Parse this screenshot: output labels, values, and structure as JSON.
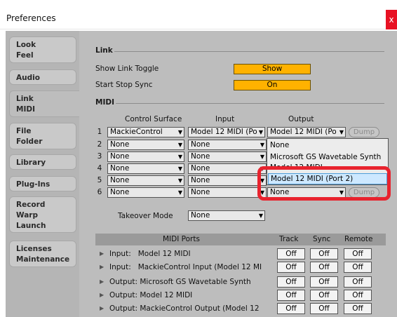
{
  "window": {
    "title": "Preferences",
    "close_glyph": "x"
  },
  "sidebar": {
    "tabs": [
      {
        "label": "Look\nFeel"
      },
      {
        "label": "Audio"
      },
      {
        "label": "Link\nMIDI",
        "active": true
      },
      {
        "label": "File\nFolder"
      },
      {
        "label": "Library"
      },
      {
        "label": "Plug-Ins"
      },
      {
        "label": "Record\nWarp\nLaunch"
      },
      {
        "label": "Licenses\nMaintenance"
      }
    ]
  },
  "link": {
    "section_title": "Link",
    "show_link_toggle_label": "Show Link Toggle",
    "show_link_toggle_value": "Show",
    "start_stop_sync_label": "Start Stop Sync",
    "start_stop_sync_value": "On"
  },
  "midi": {
    "section_title": "MIDI",
    "headers": {
      "control_surface": "Control Surface",
      "input": "Input",
      "output": "Output"
    },
    "rows": [
      {
        "num": "1",
        "surface": "MackieControl",
        "input": "Model 12 MIDI (Po",
        "output": "Model 12 MIDI (Po",
        "dump": "Dump"
      },
      {
        "num": "2",
        "surface": "None",
        "input": "None",
        "output": ""
      },
      {
        "num": "3",
        "surface": "None",
        "input": "None",
        "output": ""
      },
      {
        "num": "4",
        "surface": "None",
        "input": "None",
        "output": ""
      },
      {
        "num": "5",
        "surface": "None",
        "input": "None",
        "output": ""
      },
      {
        "num": "6",
        "surface": "None",
        "input": "None",
        "output": "None",
        "dump": "Dump"
      }
    ],
    "output_menu": {
      "items": [
        "None",
        "Microsoft GS Wavetable Synth",
        "Model 12 MIDI",
        "Model 12 MIDI (Port 2)"
      ],
      "highlighted": "Model 12 MIDI (Port 2)"
    },
    "takeover_mode_label": "Takeover Mode",
    "takeover_mode_value": "None"
  },
  "midi_ports": {
    "headers": {
      "ports": "MIDI Ports",
      "track": "Track",
      "sync": "Sync",
      "remote": "Remote"
    },
    "rows": [
      {
        "direction": "Input:",
        "name": "Model 12 MIDI",
        "track": "Off",
        "sync": "Off",
        "remote": "Off"
      },
      {
        "direction": "Input:",
        "name": "MackieControl Input (Model 12 MI",
        "track": "Off",
        "sync": "Off",
        "remote": "Off"
      },
      {
        "direction": "Output:",
        "name": "Microsoft GS Wavetable Synth",
        "track": "Off",
        "sync": "Off",
        "remote": "Off"
      },
      {
        "direction": "Output:",
        "name": "Model 12 MIDI",
        "track": "Off",
        "sync": "Off",
        "remote": "Off"
      },
      {
        "direction": "Output:",
        "name": "MackieControl Output (Model 12",
        "track": "Off",
        "sync": "Off",
        "remote": "Off"
      }
    ]
  },
  "colors": {
    "toggle_on": "#ffb200",
    "annotation": "#e8232e",
    "highlight": "#cde8ff"
  }
}
